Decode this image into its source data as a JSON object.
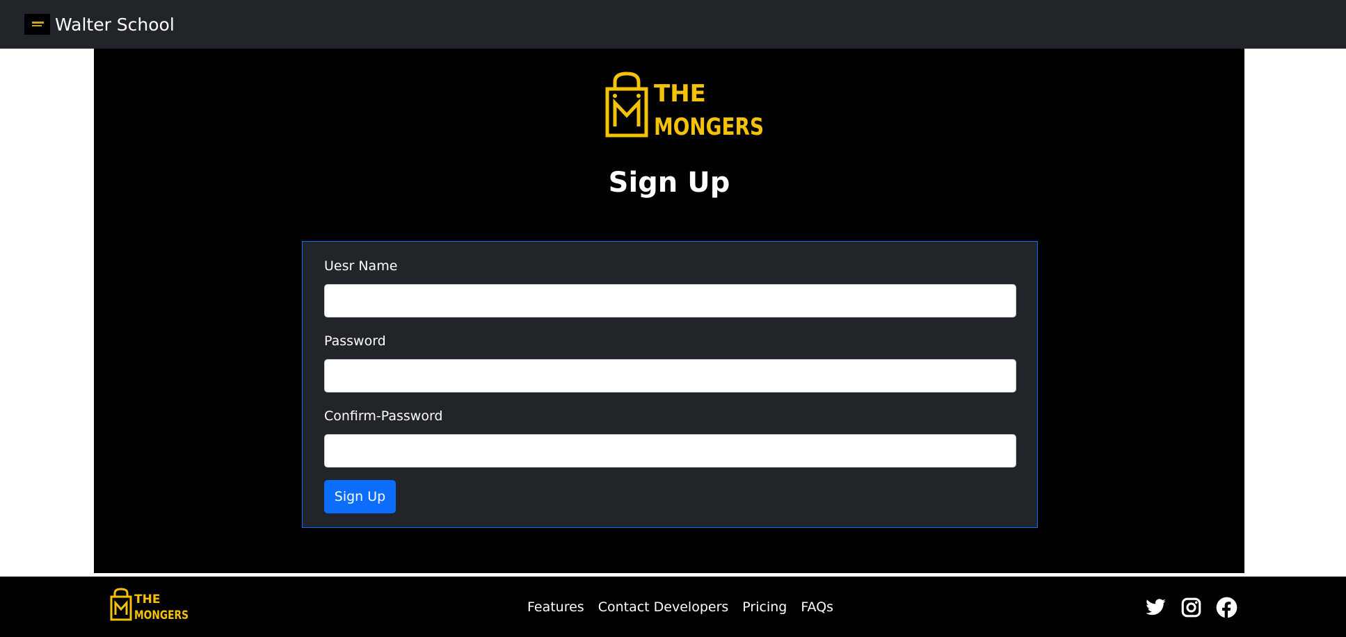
{
  "navbar": {
    "brand": "Walter School"
  },
  "logo": {
    "line1": "THE",
    "line2": "MONGERS",
    "color": "#f5c20a"
  },
  "page": {
    "title": "Sign Up"
  },
  "form": {
    "username_label": "Uesr Name",
    "username_value": "",
    "password_label": "Password",
    "password_value": "",
    "confirm_label": "Confirm-Password",
    "confirm_value": "",
    "submit_label": "Sign Up"
  },
  "footer": {
    "links": [
      "Features",
      "Contact Developers",
      "Pricing",
      "FAQs"
    ],
    "social": [
      "twitter-icon",
      "instagram-icon",
      "facebook-icon"
    ]
  },
  "colors": {
    "accent": "#0d6efd",
    "dark": "#212529",
    "brand_yellow": "#f5c20a"
  }
}
